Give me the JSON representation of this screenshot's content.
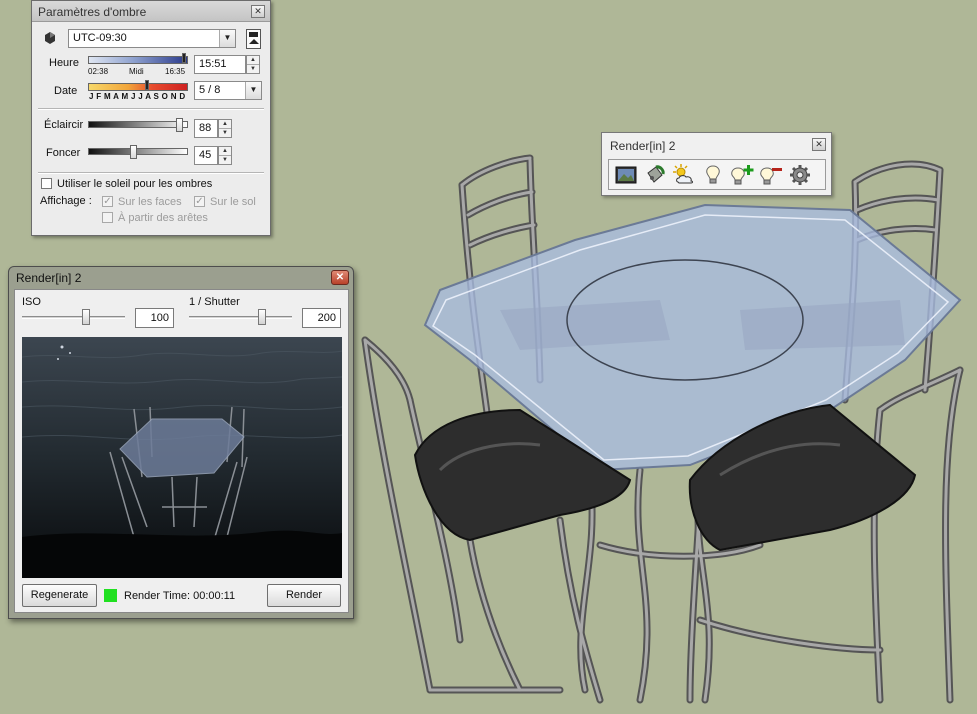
{
  "shadow_panel": {
    "title": "Paramètres d'ombre",
    "timezone": "UTC-09:30",
    "time_label": "Heure",
    "time_start": "02:38",
    "time_mid": "Midi",
    "time_end": "16:35",
    "time_value": "15:51",
    "date_label": "Date",
    "months": "J F M A M J J A S O N D",
    "date_value": "5 / 8",
    "lighten_label": "Éclaircir",
    "lighten_value": "88",
    "darken_label": "Foncer",
    "darken_value": "45",
    "use_sun_label": "Utiliser le soleil pour les ombres",
    "display_label": "Affichage :",
    "on_faces_label": "Sur les faces",
    "on_ground_label": "Sur le sol",
    "from_edges_label": "À partir des arêtes",
    "on_faces_checked": true,
    "on_ground_checked": true,
    "from_edges_checked": false,
    "use_sun_checked": false
  },
  "toolbar": {
    "title": "Render[in] 2",
    "buttons": [
      "render-image-icon",
      "material-bucket-icon",
      "sun-sky-icon",
      "light-bulb-icon",
      "add-light-icon",
      "remove-light-icon",
      "settings-gear-icon"
    ]
  },
  "render_window": {
    "title": "Render[in] 2",
    "iso_label": "ISO",
    "iso_value": "100",
    "shutter_label": "1 / Shutter",
    "shutter_value": "200",
    "regenerate_label": "Regenerate",
    "render_time": "Render Time: 00:00:11",
    "render_label": "Render",
    "status_color": "#20e020"
  },
  "colors": {
    "viewport_bg": "#afb797",
    "glass": "#9fb3d8",
    "cushion": "#2a2a2a",
    "metal": "#8d8d8d"
  }
}
